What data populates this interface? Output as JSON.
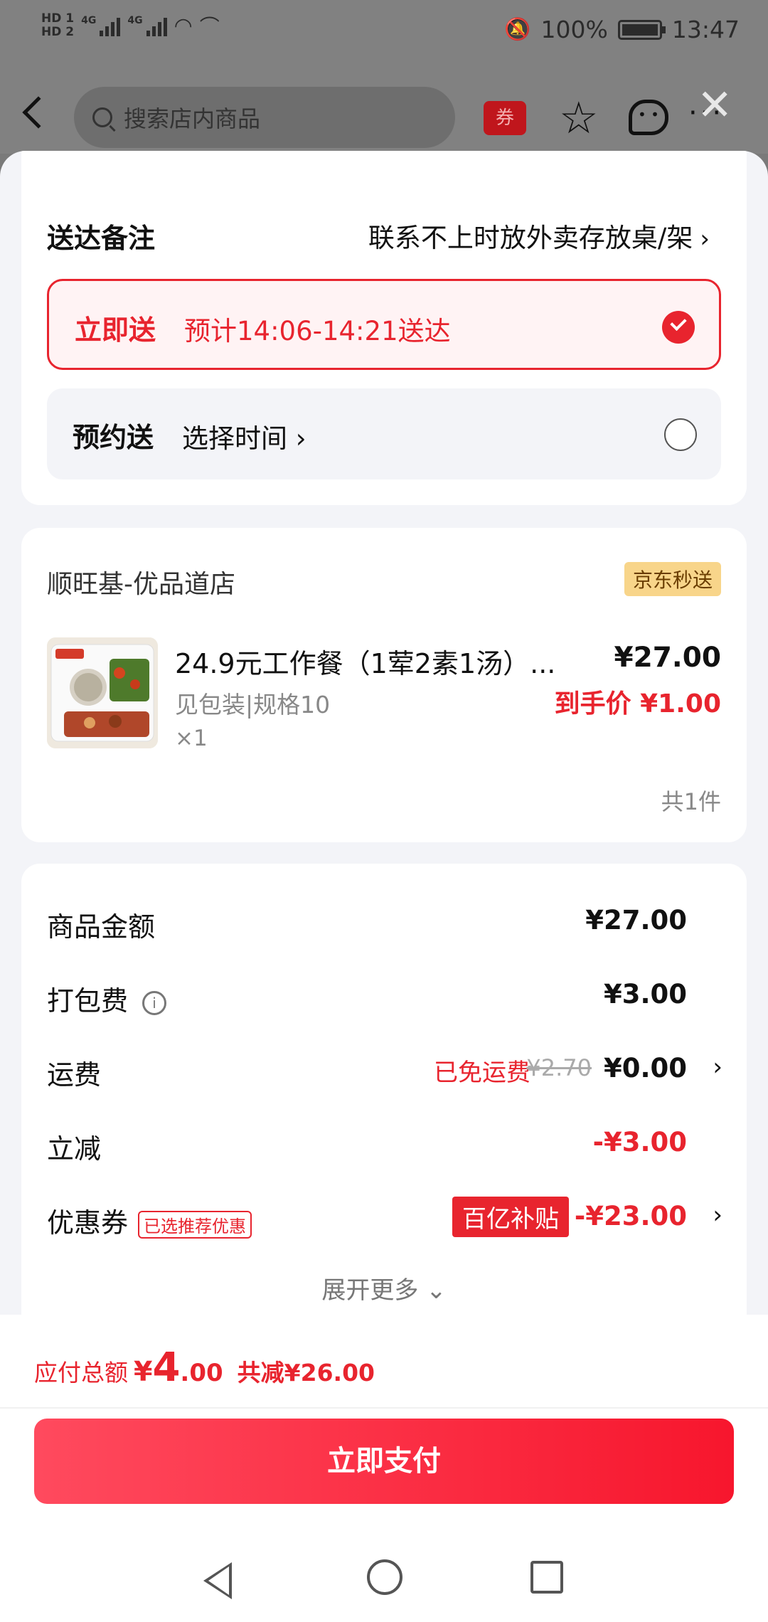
{
  "status_bar": {
    "hd1": "HD 1",
    "hd2": "HD 2",
    "net1": "4G",
    "net2": "4G",
    "battery": "100%",
    "time": "13:47"
  },
  "header": {
    "search_placeholder": "搜索店内商品",
    "coupon_icon_label": "券"
  },
  "delivery": {
    "remark_label": "送达备注",
    "remark_value": "联系不上时放外卖存放桌/架",
    "now": {
      "title": "立即送",
      "subtitle": "预计14:06-14:21送达",
      "selected": true
    },
    "scheduled": {
      "title": "预约送",
      "subtitle": "选择时间 ›",
      "selected": false
    }
  },
  "order": {
    "shop_name": "顺旺基-优品道店",
    "shop_badge": "京东秒送",
    "item": {
      "name": "24.9元工作餐（1荤2素1汤）...",
      "spec": "见包装|规格10",
      "qty": "×1",
      "price": "¥27.00",
      "final_price": "到手价 ¥1.00"
    },
    "count": "共1件"
  },
  "fees": {
    "goods_label": "商品金额",
    "goods_value": "¥27.00",
    "pack_label": "打包费",
    "pack_value": "¥3.00",
    "ship_label": "运费",
    "ship_free_text": "已免运费",
    "ship_original": "¥2.70",
    "ship_value": "¥0.00",
    "discount_label": "立减",
    "discount_value": "-¥3.00",
    "coupon_label": "优惠券",
    "coupon_tag": "已选推荐优惠",
    "coupon_badge": "百亿补贴",
    "coupon_value": "-¥23.00",
    "expand": "展开更多 ⌄"
  },
  "footer": {
    "total_label": "应付总额",
    "currency": "¥",
    "total_int": "4",
    "total_dec": ".00",
    "saved": "共减¥26.00",
    "pay_button": "立即支付"
  },
  "colors": {
    "accent_red": "#e8242e",
    "badge_gold": "#f8d58a",
    "sheet_bg": "#f3f4f8"
  }
}
